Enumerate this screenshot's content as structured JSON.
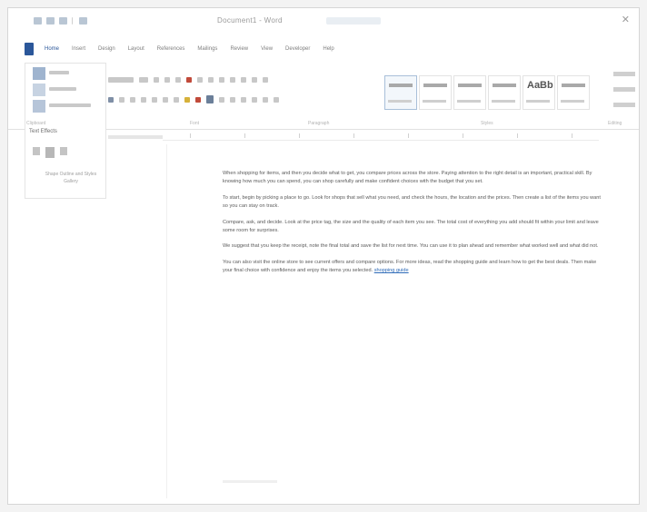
{
  "window": {
    "title": "Document1 - Word",
    "close_glyph": "✕"
  },
  "ribbon": {
    "tabs": [
      "File",
      "Home",
      "Insert",
      "Design",
      "Layout",
      "References",
      "Mailings",
      "Review",
      "View",
      "Developer",
      "Help"
    ],
    "active_tab": "Home",
    "left_pane": {
      "label": "Text Effects",
      "note": "Shape Outline and Styles Gallery"
    },
    "style_heading": "AaBb",
    "group_labels": [
      "Clipboard",
      "Font",
      "Paragraph",
      "Styles",
      "Editing"
    ]
  },
  "document": {
    "paragraphs": [
      "When shopping for items, and then you decide what to get, you compare prices across the store. Paying attention to the right detail is an important, practical skill. By knowing how much you can spend, you can shop carefully and make confident choices with the budget that you set.",
      "To start, begin by picking a place to go. Look for shops that sell what you need, and check the hours, the location and the prices. Then create a list of the items you want so you can stay on track.",
      "Compare, ask, and decide. Look at the price tag, the size and the quality of each item you see. The total cost of everything you add should fit within your limit and leave some room for surprises.",
      "We suggest that you keep the receipt, note the final total and save the list for next time. You can use it to plan ahead and remember what worked well and what did not.",
      "You can also visit the online store to see current offers and compare options. For more ideas, read the shopping guide and learn how to get the best deals. Then make your final choice with confidence and enjoy the items you selected."
    ],
    "link_text": "shopping guide"
  },
  "colors": {
    "accent": "#2b579a",
    "link": "#2e6bb8"
  }
}
